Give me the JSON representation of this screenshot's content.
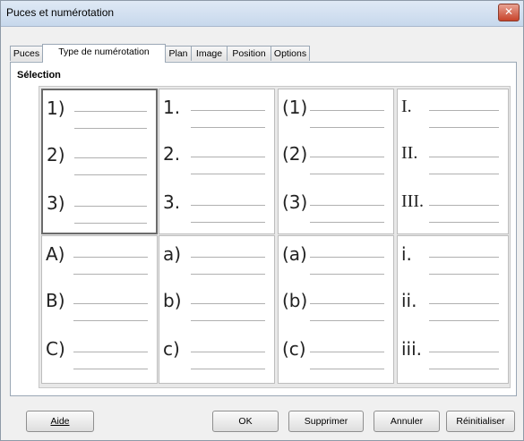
{
  "window": {
    "title": "Puces et numérotation",
    "close_icon": "close-icon"
  },
  "tabs": [
    {
      "label": "Puces"
    },
    {
      "label": "Type de numérotation",
      "active": true
    },
    {
      "label": "Plan"
    },
    {
      "label": "Image"
    },
    {
      "label": "Position"
    },
    {
      "label": "Options"
    }
  ],
  "section_label": "Sélection",
  "cells": [
    {
      "selected": true,
      "style": "sans",
      "items": [
        "1)",
        "2)",
        "3)"
      ]
    },
    {
      "style": "sans",
      "items": [
        "1.",
        "2.",
        "3."
      ]
    },
    {
      "style": "sans",
      "items": [
        "(1)",
        "(2)",
        "(3)"
      ]
    },
    {
      "style": "serif",
      "items": [
        "I.",
        "II.",
        "III."
      ]
    },
    {
      "style": "sans",
      "items": [
        "A)",
        "B)",
        "C)"
      ]
    },
    {
      "style": "sans",
      "items": [
        "a)",
        "b)",
        "c)"
      ]
    },
    {
      "style": "sans",
      "items": [
        "(a)",
        "(b)",
        "(c)"
      ]
    },
    {
      "style": "sans",
      "items": [
        "i.",
        "ii.",
        "iii."
      ]
    }
  ],
  "buttons": {
    "help": "Aide",
    "ok": "OK",
    "delete": "Supprimer",
    "cancel": "Annuler",
    "reset": "Réinitialiser"
  }
}
